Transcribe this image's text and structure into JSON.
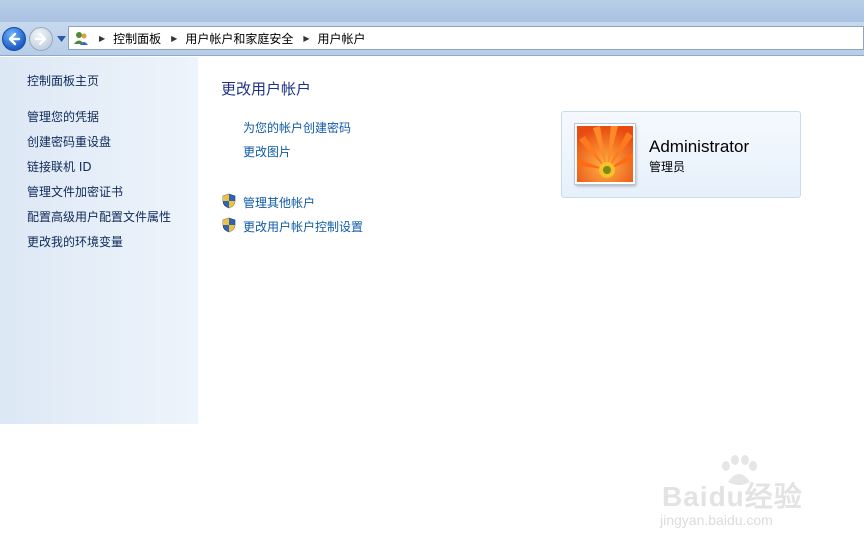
{
  "breadcrumb": [
    "控制面板",
    "用户帐户和家庭安全",
    "用户帐户"
  ],
  "sidebar": {
    "items": [
      {
        "label": "控制面板主页"
      },
      {
        "label": "管理您的凭据"
      },
      {
        "label": "创建密码重设盘"
      },
      {
        "label": "链接联机 ID"
      },
      {
        "label": "管理文件加密证书"
      },
      {
        "label": "配置高级用户配置文件属性"
      },
      {
        "label": "更改我的环境变量"
      }
    ]
  },
  "main": {
    "title": "更改用户帐户",
    "tasks": [
      {
        "label": "为您的帐户创建密码"
      },
      {
        "label": "更改图片"
      }
    ],
    "admin_tasks": [
      {
        "label": "管理其他帐户",
        "icon": "shield-icon"
      },
      {
        "label": "更改用户帐户控制设置",
        "icon": "shield-icon"
      }
    ]
  },
  "account": {
    "name": "Administrator",
    "role": "管理员"
  },
  "watermark": {
    "brand": "Baidu经验",
    "url": "jingyan.baidu.com"
  }
}
